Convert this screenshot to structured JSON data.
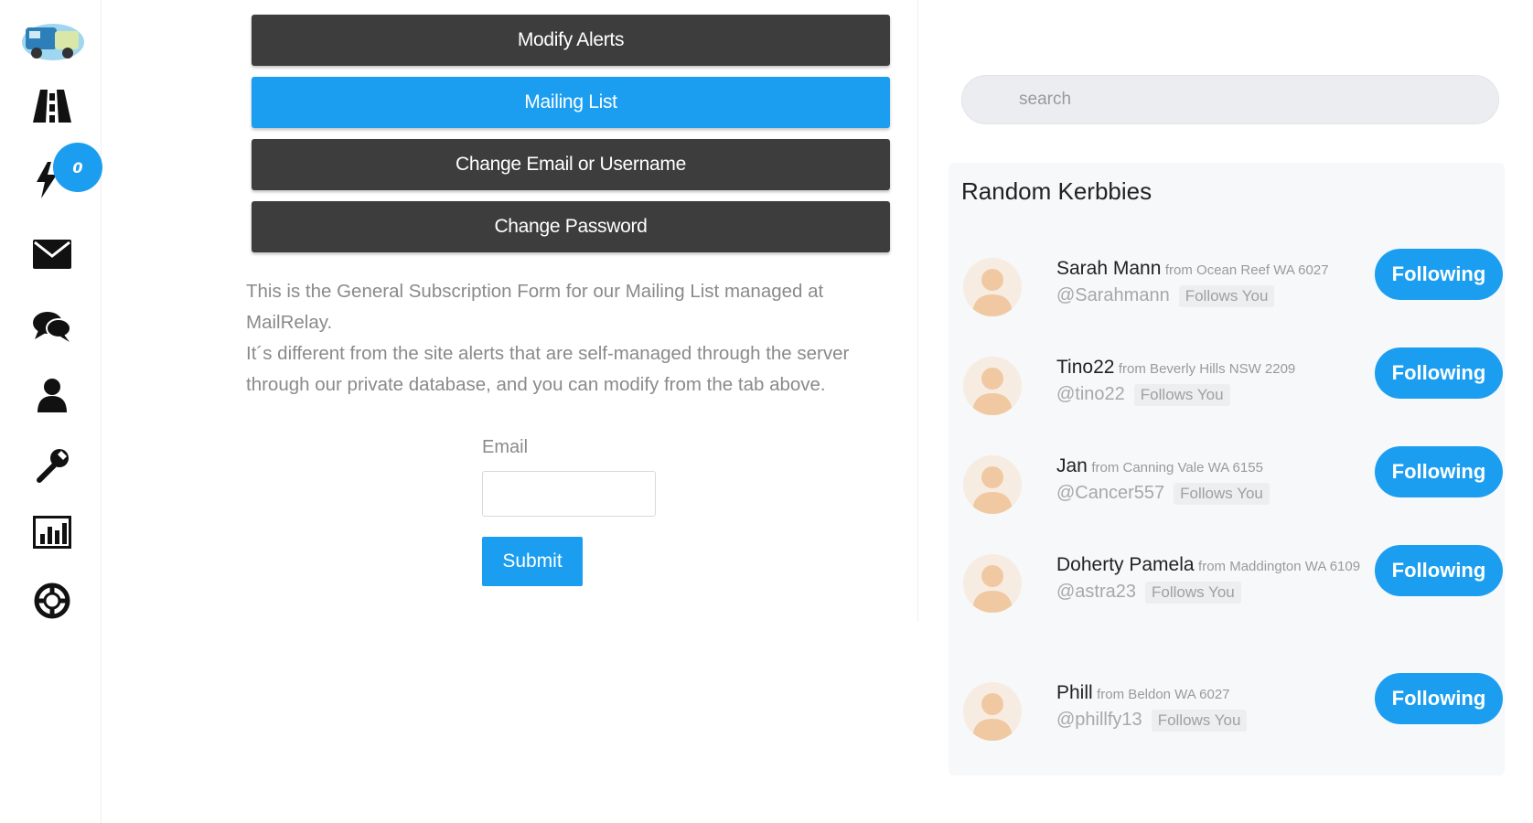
{
  "sidebar": {
    "badge_count": "0",
    "icons": [
      "truck-logo",
      "road-icon",
      "lightning-icon",
      "envelope-icon",
      "chat-icon",
      "user-icon",
      "wrench-icon",
      "chart-icon",
      "lifebuoy-icon"
    ]
  },
  "tabs": [
    {
      "label": "Modify Alerts",
      "active": false
    },
    {
      "label": "Mailing List",
      "active": true
    },
    {
      "label": "Change Email or Username",
      "active": false
    },
    {
      "label": "Change Password",
      "active": false
    }
  ],
  "intro": {
    "line1": "This is the General Subscription Form for our Mailing List managed at MailRelay.",
    "line2": "It´s different from the site alerts that are self-managed through the server through our private database, and you can modify from the tab above."
  },
  "form": {
    "email_label": "Email",
    "email_value": "",
    "submit_label": "Submit"
  },
  "search": {
    "placeholder": "search"
  },
  "kerbbies": {
    "title": "Random Kerbbies",
    "users": [
      {
        "name": "Sarah Mann",
        "from": "from Ocean Reef WA 6027",
        "handle": "@Sarahmann",
        "follows": "Follows You",
        "button": "Following"
      },
      {
        "name": "Tino22",
        "from": "from Beverly Hills NSW 2209",
        "handle": "@tino22",
        "follows": "Follows You",
        "button": "Following"
      },
      {
        "name": "Jan",
        "from": "from Canning Vale WA 6155",
        "handle": "@Cancer557",
        "follows": "Follows You",
        "button": "Following"
      },
      {
        "name": "Doherty Pamela",
        "from": "from Maddington WA 6109",
        "handle": "@astra23",
        "follows": "Follows You",
        "button": "Following"
      },
      {
        "name": "Phill",
        "from": "from Beldon WA 6027",
        "handle": "@phillfy13",
        "follows": "Follows You",
        "button": "Following"
      }
    ]
  },
  "colors": {
    "accent": "#1c9ef0",
    "dark_button": "#3d3d3d",
    "panel_bg": "#f6f8fa"
  }
}
